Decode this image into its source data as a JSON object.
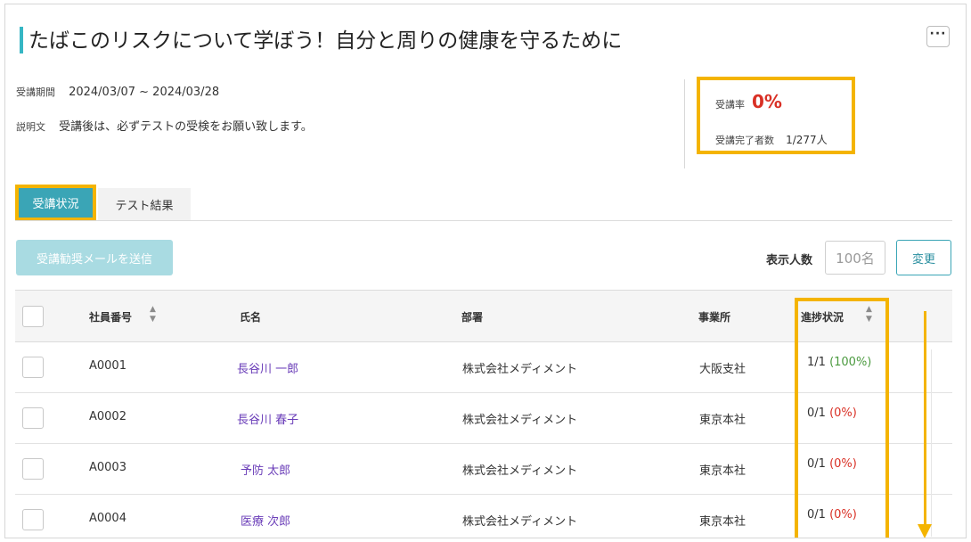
{
  "course": {
    "title": "たばこのリスクについて学ぼう！自分と周りの健康を守るために",
    "more_label": "···",
    "period_label": "受講期間",
    "period_value": "2024/03/07 ~ 2024/03/28",
    "desc_label": "説明文",
    "desc_value": "受講後は、必ずテストの受検をお願い致します。"
  },
  "stats": {
    "rate_label": "受講率",
    "rate_value": "0%",
    "done_label": "受講完了者数",
    "done_value": "1/277人"
  },
  "tabs": [
    {
      "label": "受講状況",
      "active": true
    },
    {
      "label": "テスト結果",
      "active": false
    }
  ],
  "toolbar": {
    "mail_button": "受講勧奨メールを送信",
    "count_label": "表示人数",
    "count_placeholder": "100名",
    "change_button": "変更"
  },
  "table": {
    "headers": {
      "employee_id": "社員番号",
      "name": "氏名",
      "department": "部署",
      "office": "事業所",
      "progress": "進捗状況"
    },
    "rows": [
      {
        "employee_id": "A0001",
        "name": "長谷川 一郎",
        "department": "株式会社メディメント",
        "office": "大阪支社",
        "progress": "1/1",
        "percent": "(100%)"
      },
      {
        "employee_id": "A0002",
        "name": "長谷川 春子",
        "department": "株式会社メディメント",
        "office": "東京本社",
        "progress": "0/1",
        "percent": "(0%)"
      },
      {
        "employee_id": "A0003",
        "name": "予防 太郎",
        "department": "株式会社メディメント",
        "office": "東京本社",
        "progress": "0/1",
        "percent": "(0%)"
      },
      {
        "employee_id": "A0004",
        "name": "医療 次郎",
        "department": "株式会社メディメント",
        "office": "東京本社",
        "progress": "0/1",
        "percent": "(0%)"
      }
    ]
  },
  "colors": {
    "accent": "#36b6c4",
    "highlight": "#f4b400",
    "danger": "#d93025",
    "success": "#4b9a3f",
    "link": "#6a3db8"
  },
  "icons": {
    "sort": "sort-updown-icon",
    "more": "more-dots-icon",
    "arrow": "arrow-down-icon"
  }
}
